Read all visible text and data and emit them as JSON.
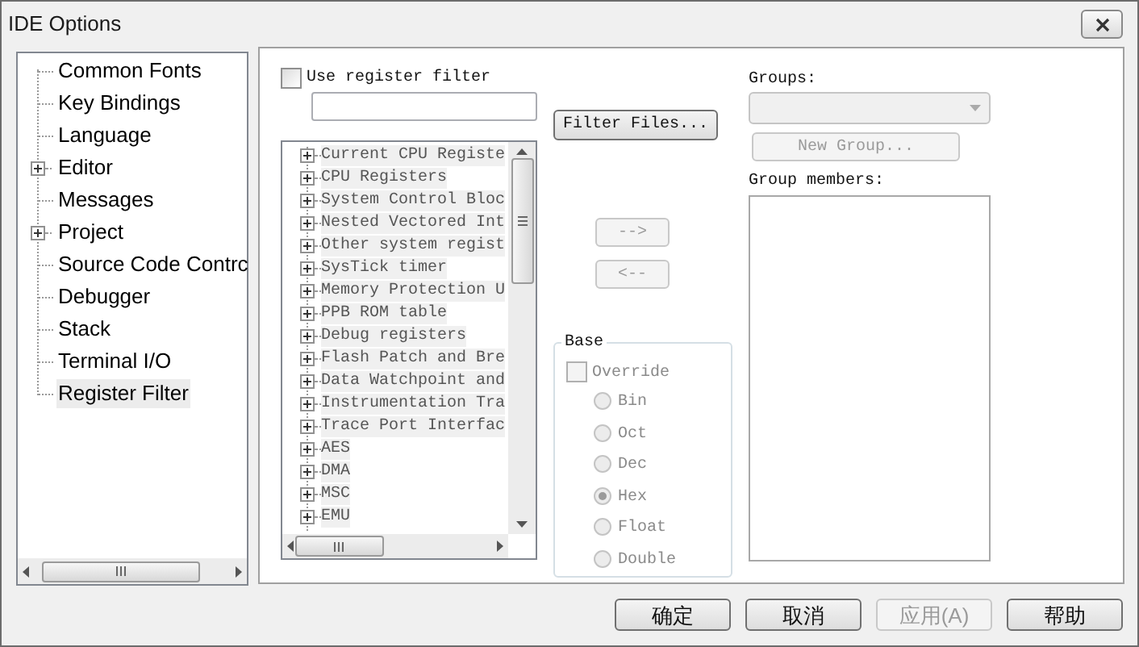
{
  "window": {
    "title": "IDE Options"
  },
  "sidebar": {
    "items": [
      {
        "label": "Common Fonts",
        "expandable": false,
        "selected": false
      },
      {
        "label": "Key Bindings",
        "expandable": false,
        "selected": false
      },
      {
        "label": "Language",
        "expandable": false,
        "selected": false
      },
      {
        "label": "Editor",
        "expandable": true,
        "selected": false
      },
      {
        "label": "Messages",
        "expandable": false,
        "selected": false
      },
      {
        "label": "Project",
        "expandable": true,
        "selected": false
      },
      {
        "label": "Source Code Contrc",
        "expandable": false,
        "selected": false
      },
      {
        "label": "Debugger",
        "expandable": false,
        "selected": false
      },
      {
        "label": "Stack",
        "expandable": false,
        "selected": false
      },
      {
        "label": "Terminal I/O",
        "expandable": false,
        "selected": false
      },
      {
        "label": "Register Filter",
        "expandable": false,
        "selected": true
      }
    ]
  },
  "register_filter": {
    "use_filter": {
      "label": "Use register filter",
      "checked": false
    },
    "filter_files_button": "Filter Files...",
    "register_groups": [
      {
        "label": "Current CPU Registe"
      },
      {
        "label": "CPU Registers"
      },
      {
        "label": "System Control Bloc"
      },
      {
        "label": "Nested Vectored Int"
      },
      {
        "label": "Other system regist"
      },
      {
        "label": "SysTick timer"
      },
      {
        "label": "Memory Protection U"
      },
      {
        "label": "PPB ROM table"
      },
      {
        "label": "Debug registers"
      },
      {
        "label": "Flash Patch and Bre"
      },
      {
        "label": "Data Watchpoint and"
      },
      {
        "label": "Instrumentation Tra"
      },
      {
        "label": "Trace Port Interfac"
      },
      {
        "label": "AES"
      },
      {
        "label": "DMA"
      },
      {
        "label": "MSC"
      },
      {
        "label": "EMU"
      }
    ],
    "add_button": {
      "label": "-->",
      "disabled": true
    },
    "remove_button": {
      "label": "<--",
      "disabled": true
    },
    "base": {
      "title": "Base",
      "override": {
        "label": "Override",
        "checked": false
      },
      "options": [
        {
          "label": "Bin",
          "selected": false
        },
        {
          "label": "Oct",
          "selected": false
        },
        {
          "label": "Dec",
          "selected": false
        },
        {
          "label": "Hex",
          "selected": true
        },
        {
          "label": "Float",
          "selected": false
        },
        {
          "label": "Double",
          "selected": false
        }
      ]
    },
    "groups": {
      "label": "Groups:",
      "disabled": true
    },
    "new_group_button": {
      "label": "New Group...",
      "disabled": true
    },
    "group_members": {
      "label": "Group members:"
    }
  },
  "buttons": [
    {
      "label": "确定",
      "disabled": false
    },
    {
      "label": "取消",
      "disabled": false
    },
    {
      "label": "应用(A)",
      "disabled": true
    },
    {
      "label": "帮助",
      "disabled": false
    }
  ]
}
